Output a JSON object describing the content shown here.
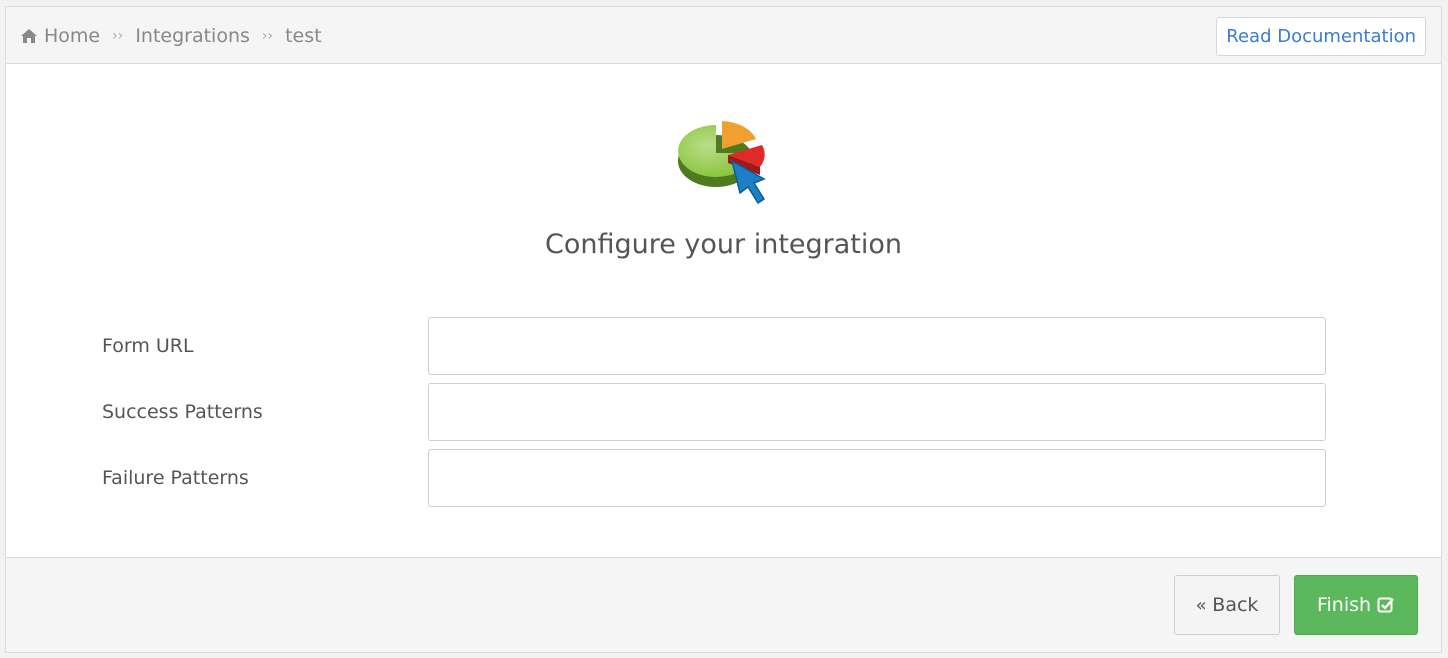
{
  "breadcrumb": {
    "home_label": "Home",
    "items": [
      "Integrations",
      "test"
    ],
    "separator": "››"
  },
  "header": {
    "doc_button_label": "Read Documentation"
  },
  "hero": {
    "icon": "pie-chart-cursor-icon"
  },
  "main": {
    "title": "Configure your integration"
  },
  "form": {
    "fields": [
      {
        "label": "Form URL",
        "value": "",
        "placeholder": ""
      },
      {
        "label": "Success Patterns",
        "value": "",
        "placeholder": ""
      },
      {
        "label": "Failure Patterns",
        "value": "",
        "placeholder": ""
      }
    ]
  },
  "footer": {
    "back_label": "Back",
    "back_icon": "double-chevron-left-icon",
    "finish_label": "Finish",
    "finish_icon": "check-square-icon"
  },
  "colors": {
    "accent_link": "#3a7bd5",
    "success": "#5cb85c"
  }
}
